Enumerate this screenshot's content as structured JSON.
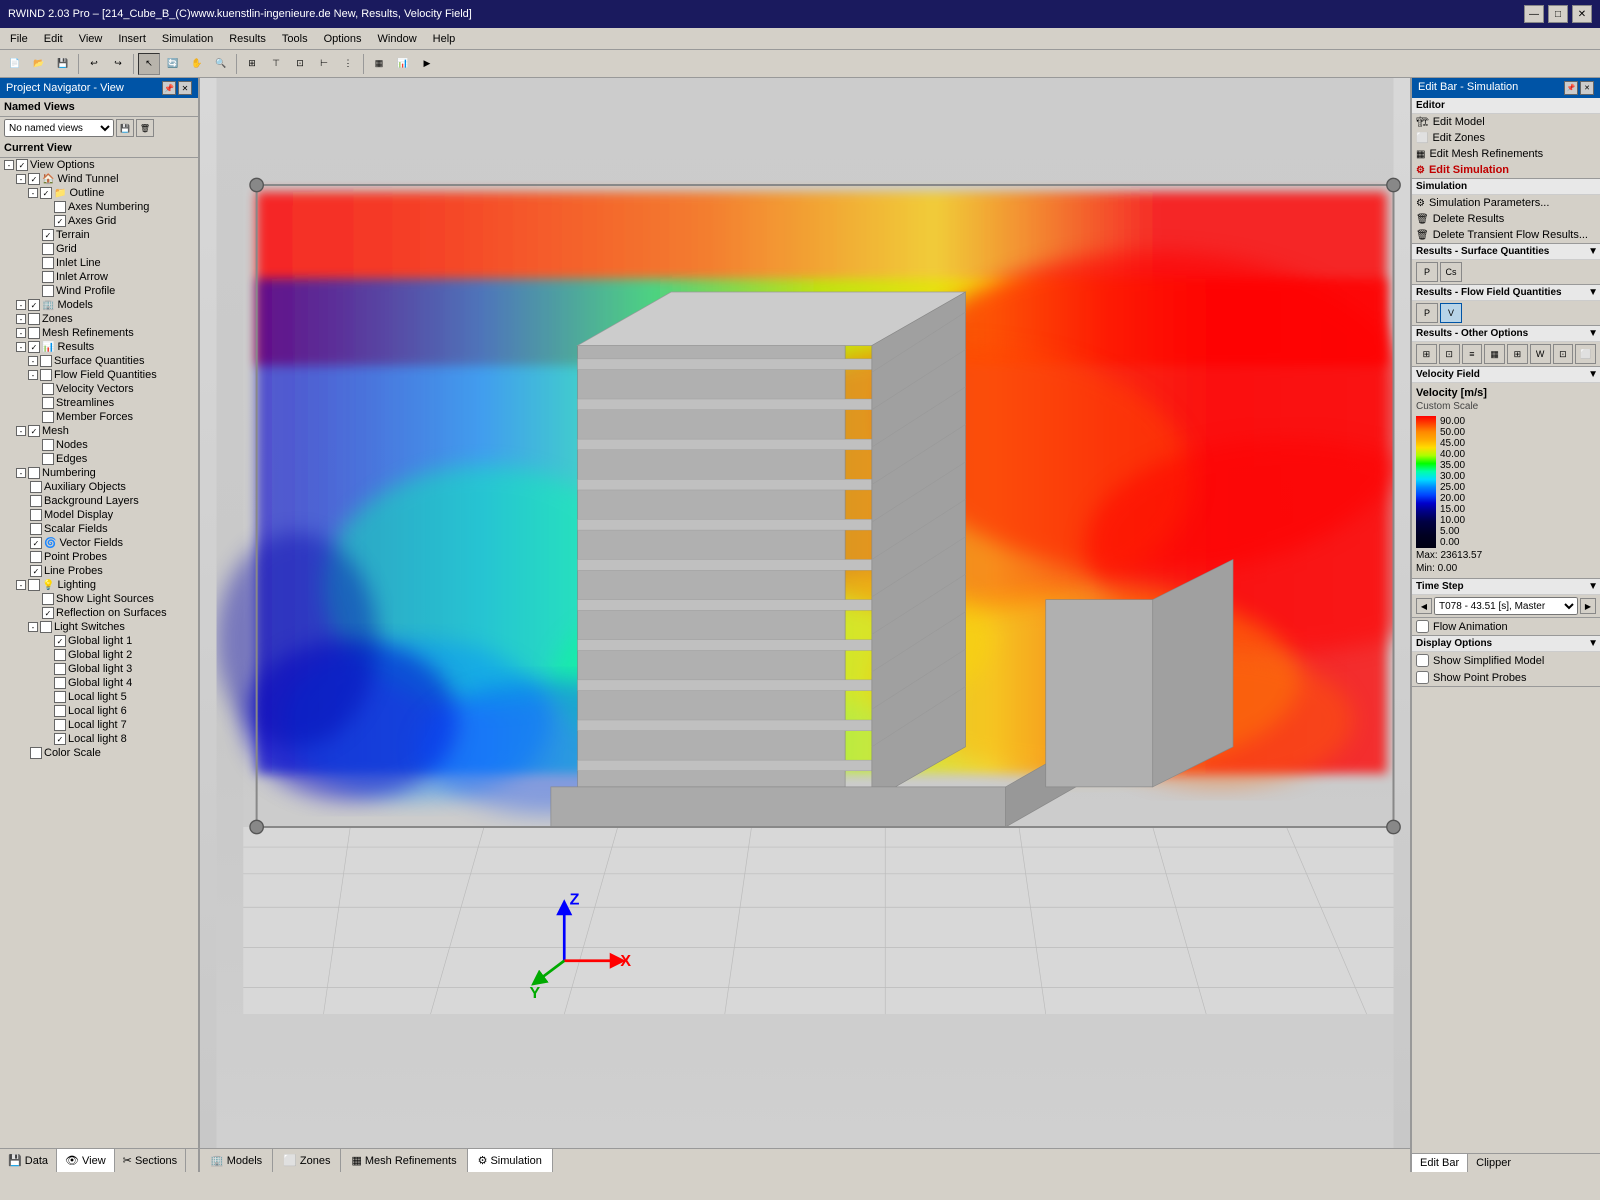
{
  "titlebar": {
    "title": "RWIND 2.03 Pro – [214_Cube_B_(C)www.kuenstlin-ingenieure.de New, Results, Velocity Field]",
    "min": "—",
    "max": "□",
    "close": "✕"
  },
  "menubar": {
    "items": [
      "File",
      "Edit",
      "View",
      "Insert",
      "Simulation",
      "Results",
      "Tools",
      "Options",
      "Window",
      "Help"
    ]
  },
  "leftPanel": {
    "header": "Project Navigator - View",
    "namedViews": {
      "label": "Named Views",
      "placeholder": "No named views"
    },
    "currentView": "Current View",
    "tree": [
      {
        "label": "View Options",
        "indent": 0,
        "expander": true,
        "checked": true,
        "icon": ""
      },
      {
        "label": "Wind Tunnel",
        "indent": 1,
        "expander": true,
        "checked": true,
        "icon": "🏠"
      },
      {
        "label": "Outline",
        "indent": 2,
        "expander": true,
        "checked": true,
        "icon": "📁"
      },
      {
        "label": "Axes Numbering",
        "indent": 3,
        "expander": false,
        "checked": false,
        "icon": ""
      },
      {
        "label": "Axes Grid",
        "indent": 3,
        "expander": false,
        "checked": true,
        "icon": ""
      },
      {
        "label": "Terrain",
        "indent": 2,
        "expander": false,
        "checked": true,
        "icon": ""
      },
      {
        "label": "Grid",
        "indent": 2,
        "expander": false,
        "checked": false,
        "icon": ""
      },
      {
        "label": "Inlet Line",
        "indent": 2,
        "expander": false,
        "checked": false,
        "icon": ""
      },
      {
        "label": "Inlet Arrow",
        "indent": 2,
        "expander": false,
        "checked": false,
        "icon": ""
      },
      {
        "label": "Wind Profile",
        "indent": 2,
        "expander": false,
        "checked": false,
        "icon": ""
      },
      {
        "label": "Models",
        "indent": 1,
        "expander": true,
        "checked": true,
        "icon": "🏢"
      },
      {
        "label": "Zones",
        "indent": 1,
        "expander": true,
        "checked": false,
        "icon": ""
      },
      {
        "label": "Mesh Refinements",
        "indent": 1,
        "expander": true,
        "checked": false,
        "icon": ""
      },
      {
        "label": "Results",
        "indent": 1,
        "expander": true,
        "checked": true,
        "icon": "📊"
      },
      {
        "label": "Surface Quantities",
        "indent": 2,
        "expander": true,
        "checked": false,
        "icon": ""
      },
      {
        "label": "Flow Field Quantities",
        "indent": 2,
        "expander": true,
        "checked": false,
        "icon": ""
      },
      {
        "label": "Velocity Vectors",
        "indent": 2,
        "expander": false,
        "checked": false,
        "icon": ""
      },
      {
        "label": "Streamlines",
        "indent": 2,
        "expander": false,
        "checked": false,
        "icon": ""
      },
      {
        "label": "Member Forces",
        "indent": 2,
        "expander": false,
        "checked": false,
        "icon": ""
      },
      {
        "label": "Mesh",
        "indent": 1,
        "expander": true,
        "checked": true,
        "icon": ""
      },
      {
        "label": "Nodes",
        "indent": 2,
        "expander": false,
        "checked": false,
        "icon": ""
      },
      {
        "label": "Edges",
        "indent": 2,
        "expander": false,
        "checked": false,
        "icon": ""
      },
      {
        "label": "Numbering",
        "indent": 1,
        "expander": true,
        "checked": false,
        "icon": ""
      },
      {
        "label": "Auxiliary Objects",
        "indent": 1,
        "expander": false,
        "checked": false,
        "icon": ""
      },
      {
        "label": "Background Layers",
        "indent": 1,
        "expander": false,
        "checked": false,
        "icon": ""
      },
      {
        "label": "Model Display",
        "indent": 1,
        "expander": false,
        "checked": false,
        "icon": ""
      },
      {
        "label": "Scalar Fields",
        "indent": 1,
        "expander": false,
        "checked": false,
        "icon": ""
      },
      {
        "label": "Vector Fields",
        "indent": 1,
        "expander": false,
        "checked": true,
        "icon": "🌀"
      },
      {
        "label": "Point Probes",
        "indent": 1,
        "expander": false,
        "checked": false,
        "icon": ""
      },
      {
        "label": "Line Probes",
        "indent": 1,
        "expander": false,
        "checked": true,
        "icon": ""
      },
      {
        "label": "Lighting",
        "indent": 1,
        "expander": true,
        "checked": false,
        "icon": "💡"
      },
      {
        "label": "Show Light Sources",
        "indent": 2,
        "expander": false,
        "checked": false,
        "icon": ""
      },
      {
        "label": "Reflection on Surfaces",
        "indent": 2,
        "expander": false,
        "checked": true,
        "icon": ""
      },
      {
        "label": "Light Switches",
        "indent": 2,
        "expander": true,
        "checked": false,
        "icon": ""
      },
      {
        "label": "Global light 1",
        "indent": 3,
        "expander": false,
        "checked": true,
        "icon": ""
      },
      {
        "label": "Global light 2",
        "indent": 3,
        "expander": false,
        "checked": false,
        "icon": ""
      },
      {
        "label": "Global light 3",
        "indent": 3,
        "expander": false,
        "checked": false,
        "icon": ""
      },
      {
        "label": "Global light 4",
        "indent": 3,
        "expander": false,
        "checked": false,
        "icon": ""
      },
      {
        "label": "Local light 5",
        "indent": 3,
        "expander": false,
        "checked": false,
        "icon": ""
      },
      {
        "label": "Local light 6",
        "indent": 3,
        "expander": false,
        "checked": false,
        "icon": ""
      },
      {
        "label": "Local light 7",
        "indent": 3,
        "expander": false,
        "checked": false,
        "icon": ""
      },
      {
        "label": "Local light 8",
        "indent": 3,
        "expander": false,
        "checked": true,
        "icon": ""
      },
      {
        "label": "Color Scale",
        "indent": 1,
        "expander": false,
        "checked": false,
        "icon": ""
      }
    ],
    "bottomTabs": [
      "Data",
      "View",
      "Sections"
    ]
  },
  "rightPanel": {
    "header": "Edit Bar - Simulation",
    "editor": {
      "label": "Editor",
      "items": [
        "Edit Model",
        "Edit Zones",
        "Edit Mesh Refinements",
        "Edit Simulation"
      ]
    },
    "simulation": {
      "label": "Simulation",
      "items": [
        "Simulation Parameters...",
        "Delete Results",
        "Delete Transient Flow Results..."
      ]
    },
    "surfaceQuantities": {
      "label": "Results - Surface Quantities",
      "buttons": [
        "P",
        "Cs"
      ]
    },
    "flowFieldQuantities": {
      "label": "Results - Flow Field Quantities",
      "buttons": [
        "P",
        "V"
      ],
      "activeBtn": "V"
    },
    "otherOptions": {
      "label": "Results - Other Options",
      "buttons": [
        "btn1",
        "btn2",
        "btn3",
        "btn4",
        "btn5",
        "btn6",
        "btn7",
        "btn8"
      ]
    },
    "velocityField": {
      "label": "Velocity Field",
      "unit": "Velocity [m/s]",
      "scaleType": "Custom Scale",
      "values": [
        90.0,
        50.0,
        45.0,
        40.0,
        35.0,
        30.0,
        25.0,
        20.0,
        15.0,
        10.0,
        5.0,
        0.0
      ],
      "maxVal": "23613.57",
      "minVal": "0.00"
    },
    "timeStep": {
      "label": "Time Step",
      "value": "T078 - 43.51 [s], Master"
    },
    "flowAnimation": "Flow Animation",
    "displayOptions": {
      "label": "Display Options",
      "items": [
        "Show Simplified Model",
        "Show Point Probes"
      ]
    }
  },
  "viewportBottomTabs": [
    "Models",
    "Zones",
    "Mesh Refinements",
    "Simulation"
  ],
  "axes": {
    "x": "X",
    "y": "Y",
    "z": "Z"
  }
}
